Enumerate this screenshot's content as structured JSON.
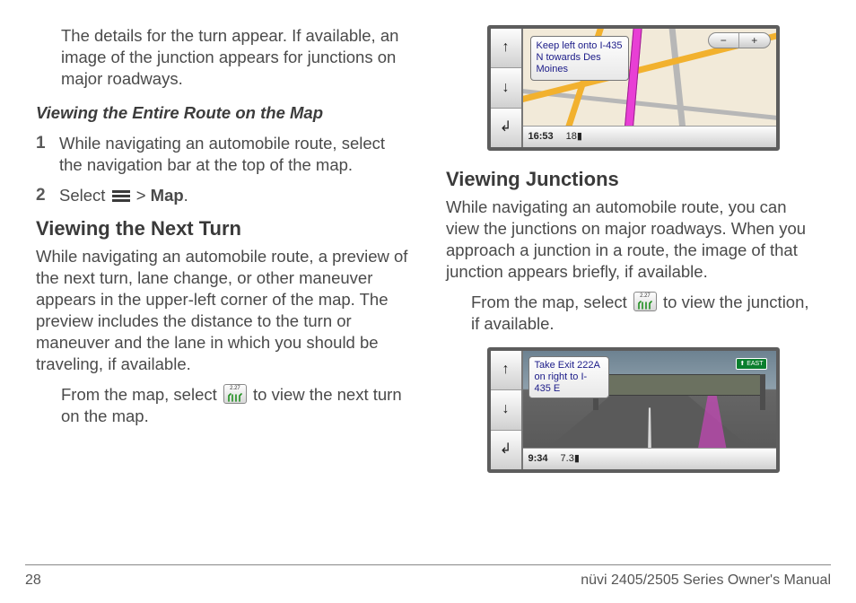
{
  "col1": {
    "intro": "The details for the turn appear. If available, an image of the junction appears for junctions on major roadways.",
    "sub1": "Viewing the Entire Route on the Map",
    "step1": "While navigating an automobile route, select the navigation bar at the top of the map.",
    "step2_a": "Select ",
    "step2_b": " > ",
    "step2_map": "Map",
    "step2_c": ".",
    "head2": "Viewing the Next Turn",
    "p2": "While navigating an automobile route, a preview of the next turn, lane change, or other maneuver appears in the upper-left corner of the map. The preview includes the distance to the turn or maneuver and the lane in which you should be traveling, if available.",
    "p3_a": "From the map, select ",
    "p3_b": " to view the next turn on the map.",
    "num1": "1",
    "num2": "2"
  },
  "col2": {
    "head1": "Viewing Junctions",
    "p1": "While navigating an automobile route, you can view the junctions on major roadways. When you approach a junction in a route, the image of that junction appears briefly, if available.",
    "p2_a": "From the map, select ",
    "p2_b": " to view the junction, if available."
  },
  "shot1": {
    "popup": "Keep left onto I-435 N towards Des Moines",
    "time": "16:53",
    "dist": "18▮",
    "zoom_minus": "−",
    "zoom_plus": "+",
    "arrow_up": "↑",
    "arrow_down": "↓",
    "arrow_back": "↲"
  },
  "shot2": {
    "popup": "Take Exit 222A on right to I-435 E",
    "sign": "⬆ EAST",
    "time": "9:34",
    "dist": "7.3▮",
    "arrow_up": "↑",
    "arrow_down": "↓",
    "arrow_back": "↲"
  },
  "footer": {
    "page": "28",
    "title": "nüvi 2405/2505 Series Owner's Manual"
  }
}
